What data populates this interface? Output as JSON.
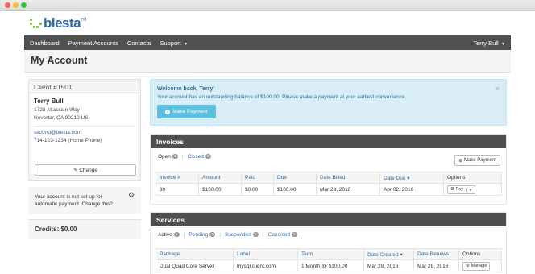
{
  "brand": {
    "name": "blesta",
    "tm": "TM"
  },
  "nav": {
    "items": [
      "Dashboard",
      "Payment Accounts",
      "Contacts",
      "Support"
    ],
    "user": "Terry Bull"
  },
  "page": {
    "title": "My Account"
  },
  "client": {
    "heading": "Client #1501",
    "name": "Terry Bull",
    "address1": "1728 Atlassian Way",
    "address2": "Nevertar, CA 90210 US",
    "email": "second@blesta.com",
    "phone": "714-123-1234 (Home Phone)",
    "change_label": "Change"
  },
  "autopay": {
    "text": "Your account is not set up for automatic payment. Change this?"
  },
  "credits": {
    "label": "Credits: $0.00"
  },
  "alert": {
    "title": "Welcome back, Terry!",
    "text": "Your account has an outstanding balance of $100.00. Please make a payment at your earliest convenience.",
    "button": "Make Payment",
    "close": "×"
  },
  "invoices": {
    "title": "Invoices",
    "filters": [
      {
        "label": "Open",
        "count": "1"
      },
      {
        "label": "Closed",
        "count": "0"
      }
    ],
    "make_payment": "Make Payment",
    "columns": [
      "Invoice #",
      "Amount",
      "Paid",
      "Due",
      "Date Billed",
      "Date Due",
      "Options"
    ],
    "rows": [
      {
        "invoice": "39",
        "amount": "$100.00",
        "paid": "$0.00",
        "due": "$100.00",
        "billed": "Mar 28, 2016",
        "date_due": "Apr 02, 2016",
        "option": "Pay"
      }
    ]
  },
  "services": {
    "title": "Services",
    "filters": [
      {
        "label": "Active",
        "count": "1"
      },
      {
        "label": "Pending",
        "count": "0"
      },
      {
        "label": "Suspended",
        "count": "0"
      },
      {
        "label": "Canceled",
        "count": "0"
      }
    ],
    "columns": [
      "Package",
      "Label",
      "Term",
      "Date Created",
      "Date Renews",
      "Options"
    ],
    "rows": [
      {
        "package": "Dual Quad Core Server",
        "label": "mysql.client.com",
        "term": "1 Month @ $100.00",
        "created": "Mar 28, 2016",
        "renews": "Mar 28, 2016",
        "option": "Manage"
      }
    ]
  },
  "colors": {
    "nav": "#505050",
    "link": "#2d6aa8",
    "alert_bg": "#d9edf7",
    "info_button": "#5bc0de",
    "logo_green": "#7dbb3b"
  }
}
